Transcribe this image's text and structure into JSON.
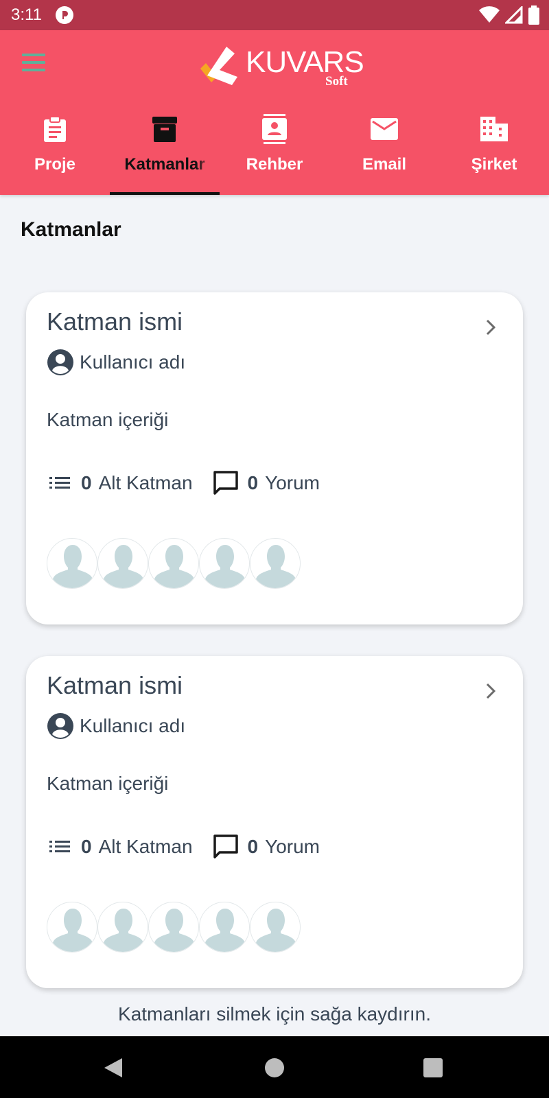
{
  "status_bar": {
    "time": "3:11"
  },
  "header": {
    "logo_text": "KUVARS",
    "logo_sub": "Soft",
    "tabs": [
      {
        "label": "Proje",
        "icon": "clipboard-icon",
        "active": false
      },
      {
        "label": "Katmanlar",
        "icon": "archive-icon",
        "active": true
      },
      {
        "label": "Rehber",
        "icon": "contacts-icon",
        "active": false
      },
      {
        "label": "Email",
        "icon": "email-icon",
        "active": false
      },
      {
        "label": "Şirket",
        "icon": "building-icon",
        "active": false
      }
    ]
  },
  "page": {
    "title": "Katmanlar"
  },
  "cards": [
    {
      "title": "Katman ismi",
      "user": "Kullanıcı adı",
      "content": "Katman içeriği",
      "sub_count": "0",
      "sub_label": "Alt Katman",
      "comment_count": "0",
      "comment_label": "Yorum"
    },
    {
      "title": "Katman ismi",
      "user": "Kullanıcı adı",
      "content": "Katman içeriği",
      "sub_count": "0",
      "sub_label": "Alt Katman",
      "comment_count": "0",
      "comment_label": "Yorum"
    }
  ],
  "footer": {
    "hint": "Katmanları silmek için sağa kaydırın."
  },
  "colors": {
    "header": "#f55266",
    "status_bar": "#b3354a",
    "text": "#3a4756",
    "avatar": "#c5d9dc"
  }
}
